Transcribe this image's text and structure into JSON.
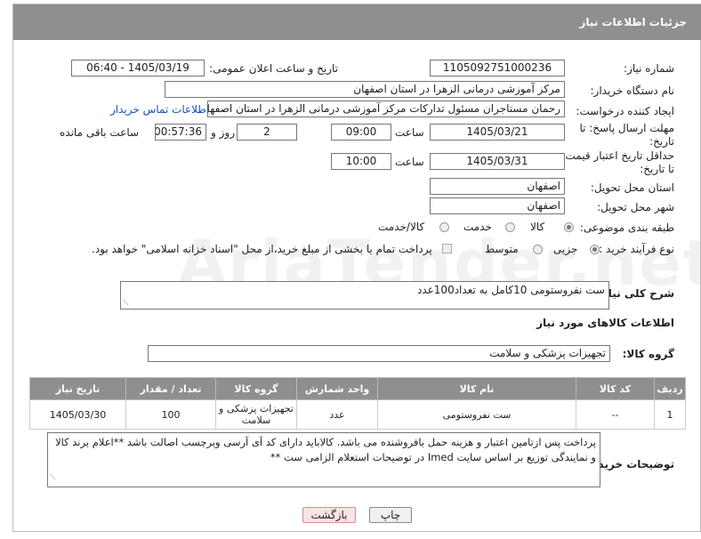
{
  "header": {
    "title": "جزئیات اطلاعات نیاز"
  },
  "watermark": "AriaTender.net",
  "fields": {
    "need_number_label": "شماره نیاز:",
    "need_number": "1105092751000236",
    "announce_label": "تاریخ و ساعت اعلان عمومی:",
    "announce_value": "1405/03/19 - 06:40",
    "buyer_label": "نام دستگاه خریدار:",
    "buyer_value": "مرکز آموزشی درمانی الزهرا در استان اصفهان",
    "creator_label": "ایجاد کننده درخواست:",
    "creator_value": "رحمان مستاجران مسئول تدارکات مرکز آموزشی درمانی الزهرا در استان اصفهان",
    "contact_link": "اطلاعات تماس خریدار",
    "deadline_label": "مهلت ارسال پاسخ: تا تاریخ:",
    "deadline_date": "1405/03/21",
    "time_label": "ساعت",
    "deadline_time": "09:00",
    "days_value": "2",
    "days_label": "روز و",
    "remaining_time": "00:57:36",
    "remaining_label": "ساعت باقی مانده",
    "validity_label": "حداقل تاریخ اعتبار قیمت: تا تاریخ:",
    "validity_date": "1405/03/31",
    "validity_time": "10:00",
    "province_label": "استان محل تحویل:",
    "province_value": "اصفهان",
    "city_label": "شهر محل تحویل:",
    "city_value": "اصفهان",
    "category_label": "طبقه بندی موضوعی:",
    "category_options": [
      "کالا",
      "خدمت",
      "کالا/خدمت"
    ],
    "process_label": "نوع فرآیند خرید :",
    "process_options": [
      "جزیی",
      "متوسط"
    ],
    "payment_note": "پرداخت تمام یا بخشی از مبلغ خرید،از محل \"اسناد خزانه اسلامی\" خواهد بود."
  },
  "summary": {
    "label": "شرح کلی نیاز:",
    "value": "ست نفروستومی 10کامل به تعداد100عدد"
  },
  "goods": {
    "section_title": "اطلاعات کالاهای مورد نیاز",
    "group_label": "گروه کالا:",
    "group_value": "تجهیزات پزشکی و سلامت",
    "columns": [
      "ردیف",
      "کد کالا",
      "نام کالا",
      "واحد شمارش",
      "گروه کالا",
      "تعداد / مقدار",
      "تاریخ نیاز"
    ],
    "rows": [
      [
        "1",
        "--",
        "ست نفروستومی",
        "عدد",
        "تجهیزات پزشکی و سلامت",
        "100",
        "1405/03/30"
      ]
    ]
  },
  "buyer_notes": {
    "label": "توضیحات خریدار:",
    "value": "پرداخت پس ازتامین اعتبار و هزینه حمل بافروشنده می باشد. کالاباید دارای کد آی آرسی وبرچسب اصالت باشد **اعلام برند کالا و نمایندگی توزیع بر اساس سایت Imed در توضیحات استعلام الزامی ست **"
  },
  "buttons": {
    "print": "چاپ",
    "back": "بازگشت"
  }
}
